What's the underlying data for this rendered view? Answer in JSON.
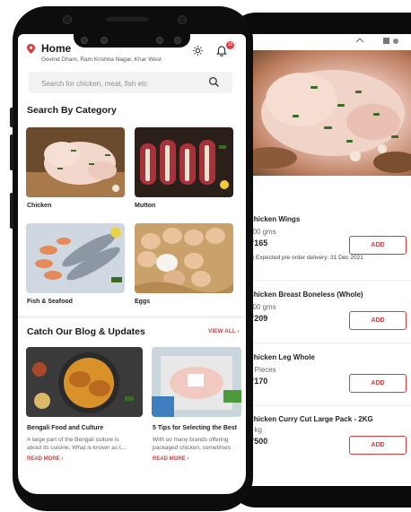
{
  "header": {
    "title": "Home",
    "address": "Govind Dham, Ram Krishna Nagar, Khar West",
    "notification_count": "10"
  },
  "search": {
    "placeholder": "Search for chicken, meat, fish etc"
  },
  "categories": {
    "title": "Search By Category",
    "items": [
      {
        "label": "Chicken"
      },
      {
        "label": "Mutton"
      },
      {
        "label": "Fish & Seafood"
      },
      {
        "label": "Eggs"
      }
    ]
  },
  "blog": {
    "title": "Catch Our Blog & Updates",
    "view_all": "VIEW ALL",
    "posts": [
      {
        "title": "Bengali Food and Culture",
        "line1": "A large part of the Bengali culture is",
        "line2": "about its cuisine. What is known as t...",
        "read_more": "READ MORE"
      },
      {
        "title": "5 Tips for Selecting the Best",
        "line1": "With so many brands offering",
        "line2": "packaged chicken, sometimes",
        "read_more": "READ MORE"
      }
    ]
  },
  "products": [
    {
      "name": "Chicken Wings",
      "weight": "500 gms",
      "price": "₹165",
      "add": "ADD",
      "note": "Expected pre order delivery: 31 Dec 2021"
    },
    {
      "name": "Chicken Breast Boneless (Whole)",
      "weight": "500 gms",
      "price": "₹209",
      "add": "ADD"
    },
    {
      "name": "Chicken Leg Whole",
      "weight": "2 Pieces",
      "price": "₹170",
      "add": "ADD"
    },
    {
      "name": "Chicken Curry Cut Large Pack - 2KG",
      "weight": "2 kg",
      "price": "₹500",
      "add": "ADD"
    }
  ],
  "colors": {
    "accent": "#d93a3a",
    "phone": "#0d0d0e"
  }
}
